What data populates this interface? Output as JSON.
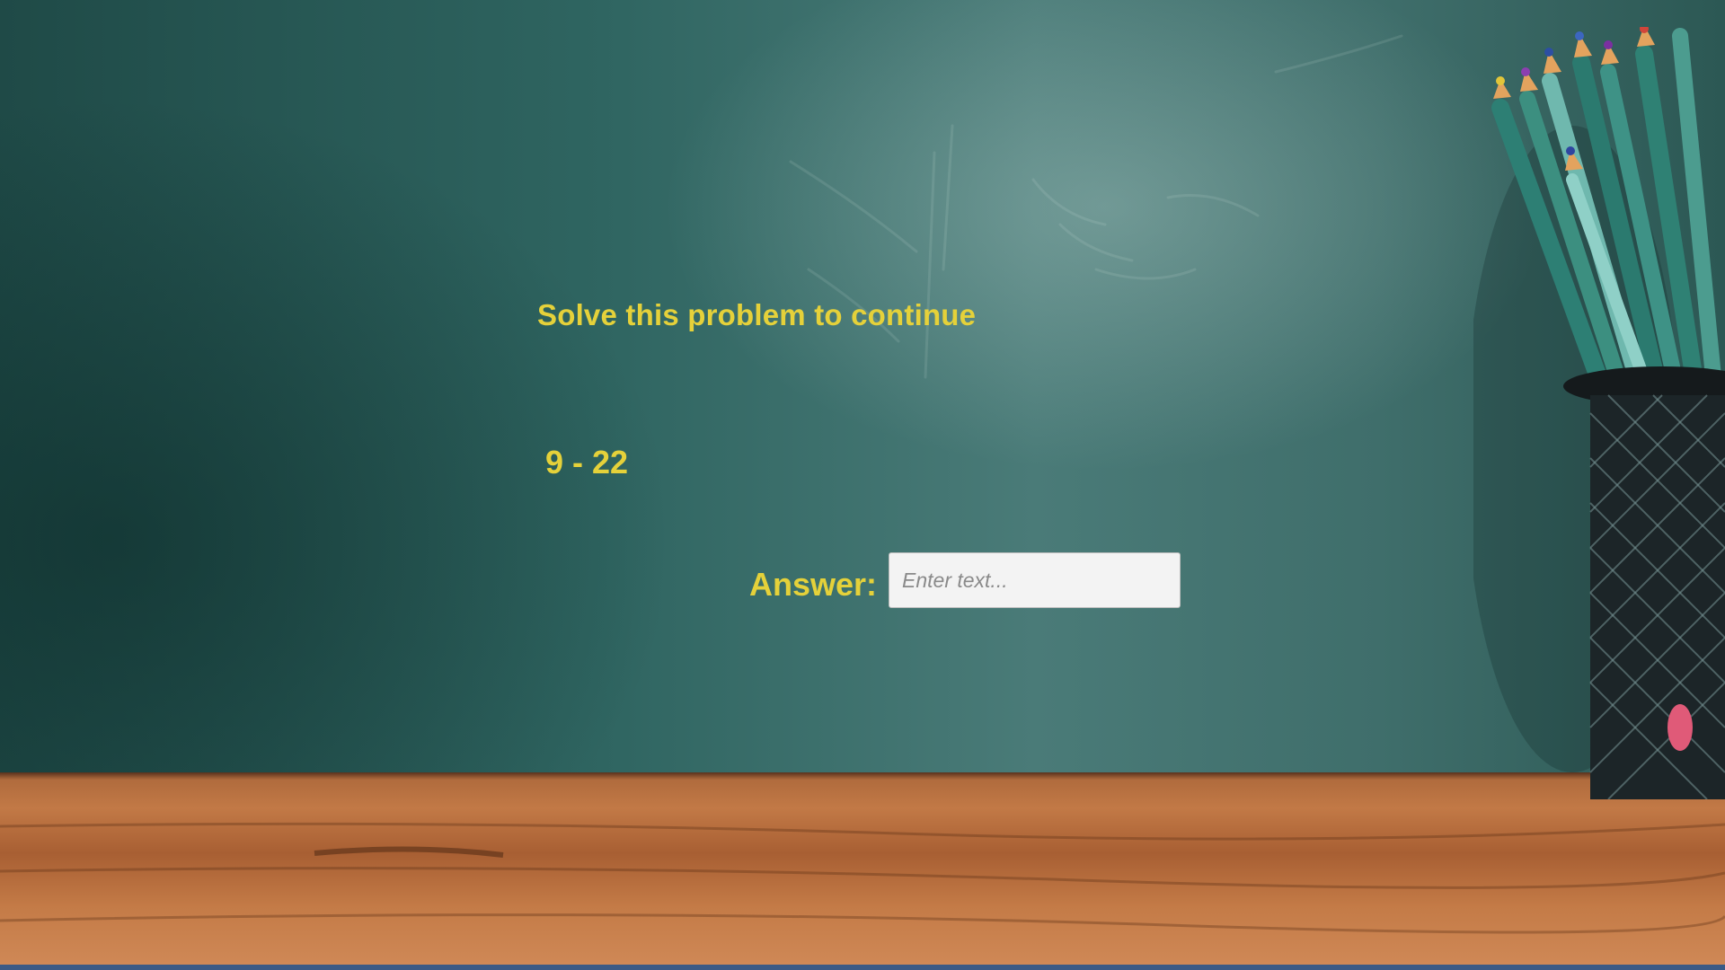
{
  "prompt": {
    "title": "Solve this problem to continue",
    "problem": "9 - 22"
  },
  "answer": {
    "label": "Answer:",
    "placeholder": "Enter text...",
    "value": ""
  },
  "colors": {
    "text": "#e5d13a",
    "chalkboard": "#2f6561",
    "desk": "#c27946",
    "bottom_bar": "#3a5a86"
  },
  "decor": {
    "background": "chalkboard-and-desk",
    "pencil_cup": "pencil-cup-icon"
  }
}
